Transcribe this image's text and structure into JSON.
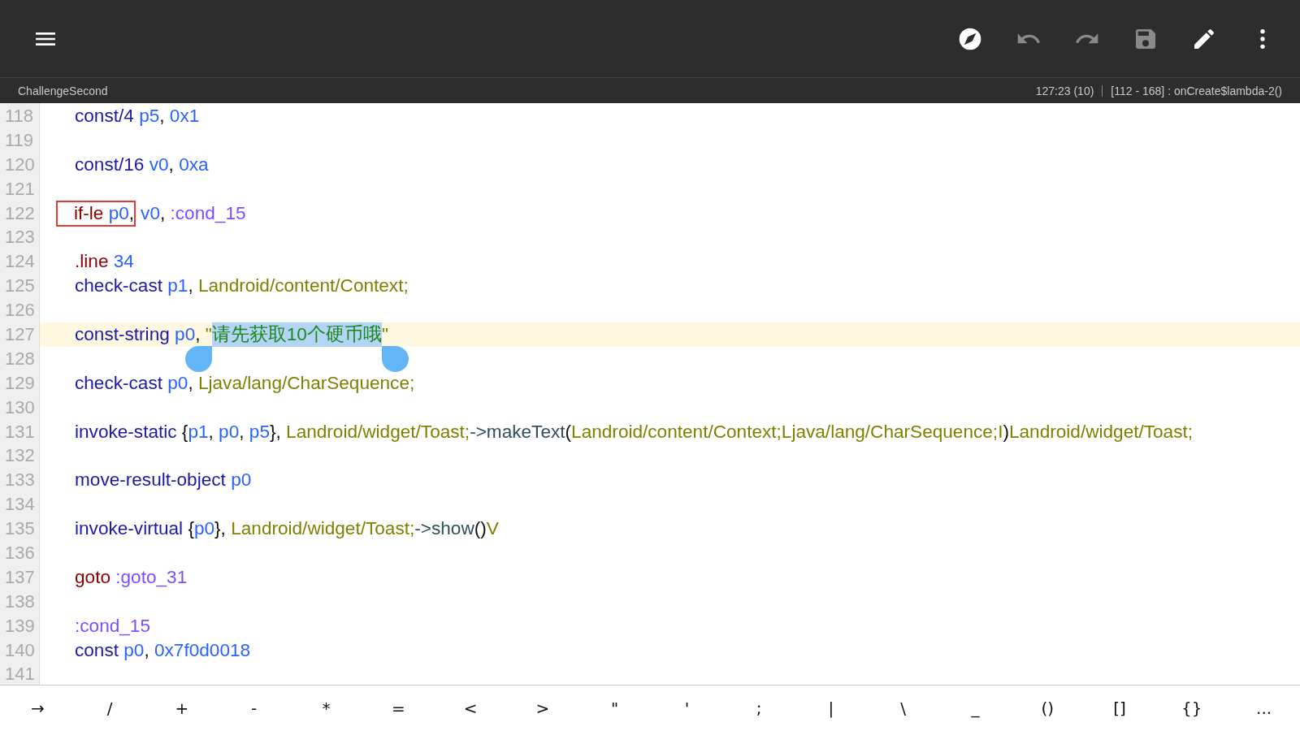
{
  "toolbar": {
    "buttons": [
      {
        "kind": "menu",
        "disabled": false
      },
      {
        "kind": "compass",
        "disabled": false
      },
      {
        "kind": "undo",
        "disabled": true
      },
      {
        "kind": "redo",
        "disabled": true
      },
      {
        "kind": "save",
        "disabled": true
      },
      {
        "kind": "pencil",
        "disabled": false
      },
      {
        "kind": "more",
        "disabled": false
      }
    ]
  },
  "status_bar": {
    "file": "ChallengeSecond",
    "position": "127:23 (10)",
    "range": "[112 - 168] : onCreate$lambda-2()"
  },
  "editor": {
    "lines": [
      {
        "number": "118",
        "current": false,
        "tokens": [
          {
            "text": "const/4 ",
            "kind": "op"
          },
          {
            "text": "p5",
            "kind": "reg"
          },
          {
            "text": ", ",
            "kind": "punct"
          },
          {
            "text": "0x1",
            "kind": "num"
          }
        ]
      },
      {
        "number": "119",
        "current": false
      },
      {
        "number": "120",
        "current": false,
        "tokens": [
          {
            "text": "const/16 ",
            "kind": "op"
          },
          {
            "text": "v0",
            "kind": "reg"
          },
          {
            "text": ", ",
            "kind": "punct"
          },
          {
            "text": "0xa",
            "kind": "num"
          }
        ]
      },
      {
        "number": "121",
        "current": false
      },
      {
        "number": "122",
        "current": false,
        "boxed_tokens": [
          {
            "text": "if-le ",
            "kind": "directive"
          },
          {
            "text": "p0",
            "kind": "reg"
          },
          {
            "text": ",",
            "kind": "punct"
          }
        ],
        "tokens": [
          {
            "text": "v0",
            "kind": "reg"
          },
          {
            "text": ", ",
            "kind": "punct"
          },
          {
            "text": ":cond_15",
            "kind": "label"
          }
        ]
      },
      {
        "number": "123",
        "current": false
      },
      {
        "number": "124",
        "current": false,
        "tokens": [
          {
            "text": ".line ",
            "kind": "directive"
          },
          {
            "text": "34",
            "kind": "num"
          }
        ]
      },
      {
        "number": "125",
        "current": false,
        "tokens": [
          {
            "text": "check-cast ",
            "kind": "op"
          },
          {
            "text": "p1",
            "kind": "reg"
          },
          {
            "text": ", ",
            "kind": "punct"
          },
          {
            "text": "Landroid/content/Context;",
            "kind": "type"
          }
        ]
      },
      {
        "number": "126",
        "current": false
      },
      {
        "number": "127",
        "current": true,
        "tokens": [
          {
            "text": "const-string ",
            "kind": "op"
          },
          {
            "text": "p0",
            "kind": "reg"
          },
          {
            "text": ", ",
            "kind": "punct"
          },
          {
            "text": "\"",
            "kind": "type"
          },
          {
            "text": "请先获取10个硬币哦",
            "kind": "str",
            "selected": true
          },
          {
            "text": "\"",
            "kind": "type"
          }
        ]
      },
      {
        "number": "128",
        "current": false
      },
      {
        "number": "129",
        "current": false,
        "tokens": [
          {
            "text": "check-cast ",
            "kind": "op"
          },
          {
            "text": "p0",
            "kind": "reg"
          },
          {
            "text": ", ",
            "kind": "punct"
          },
          {
            "text": "Ljava/lang/CharSequence;",
            "kind": "type"
          }
        ]
      },
      {
        "number": "130",
        "current": false
      },
      {
        "number": "131",
        "current": false,
        "tokens": [
          {
            "text": "invoke-static ",
            "kind": "op"
          },
          {
            "text": "{",
            "kind": "punct"
          },
          {
            "text": "p1",
            "kind": "reg"
          },
          {
            "text": ", ",
            "kind": "punct"
          },
          {
            "text": "p0",
            "kind": "reg"
          },
          {
            "text": ", ",
            "kind": "punct"
          },
          {
            "text": "p5",
            "kind": "reg"
          },
          {
            "text": "}, ",
            "kind": "punct"
          },
          {
            "text": "Landroid/widget/Toast;",
            "kind": "type"
          },
          {
            "text": "->makeText",
            "kind": "method"
          },
          {
            "text": "(",
            "kind": "punct"
          },
          {
            "text": "Landroid/content/Context;Ljava/lang/CharSequence;I",
            "kind": "type"
          },
          {
            "text": ")",
            "kind": "punct"
          },
          {
            "text": "Landroid/widget/Toast;",
            "kind": "type"
          }
        ]
      },
      {
        "number": "132",
        "current": false
      },
      {
        "number": "133",
        "current": false,
        "tokens": [
          {
            "text": "move-result-object ",
            "kind": "op"
          },
          {
            "text": "p0",
            "kind": "reg"
          }
        ]
      },
      {
        "number": "134",
        "current": false
      },
      {
        "number": "135",
        "current": false,
        "tokens": [
          {
            "text": "invoke-virtual ",
            "kind": "op"
          },
          {
            "text": "{",
            "kind": "punct"
          },
          {
            "text": "p0",
            "kind": "reg"
          },
          {
            "text": "}, ",
            "kind": "punct"
          },
          {
            "text": "Landroid/widget/Toast;",
            "kind": "type"
          },
          {
            "text": "->show",
            "kind": "method"
          },
          {
            "text": "()",
            "kind": "punct"
          },
          {
            "text": "V",
            "kind": "type"
          }
        ]
      },
      {
        "number": "136",
        "current": false
      },
      {
        "number": "137",
        "current": false,
        "tokens": [
          {
            "text": "goto ",
            "kind": "directive"
          },
          {
            "text": ":goto_31",
            "kind": "label"
          }
        ]
      },
      {
        "number": "138",
        "current": false
      },
      {
        "number": "139",
        "current": false,
        "tokens": [
          {
            "text": ":cond_15",
            "kind": "label"
          }
        ]
      },
      {
        "number": "140",
        "current": false,
        "tokens": [
          {
            "text": "const ",
            "kind": "op"
          },
          {
            "text": "p0",
            "kind": "reg"
          },
          {
            "text": ", ",
            "kind": "punct"
          },
          {
            "text": "0x7f0d0018",
            "kind": "num"
          }
        ]
      },
      {
        "number": "141",
        "current": false
      }
    ]
  },
  "symbol_bar": {
    "keys": [
      "→",
      "/",
      "+",
      "-",
      "*",
      "=",
      "<",
      ">",
      "\"",
      "'",
      ";",
      "|",
      "\\",
      "_",
      "()",
      "[]",
      "{}",
      "..."
    ]
  }
}
